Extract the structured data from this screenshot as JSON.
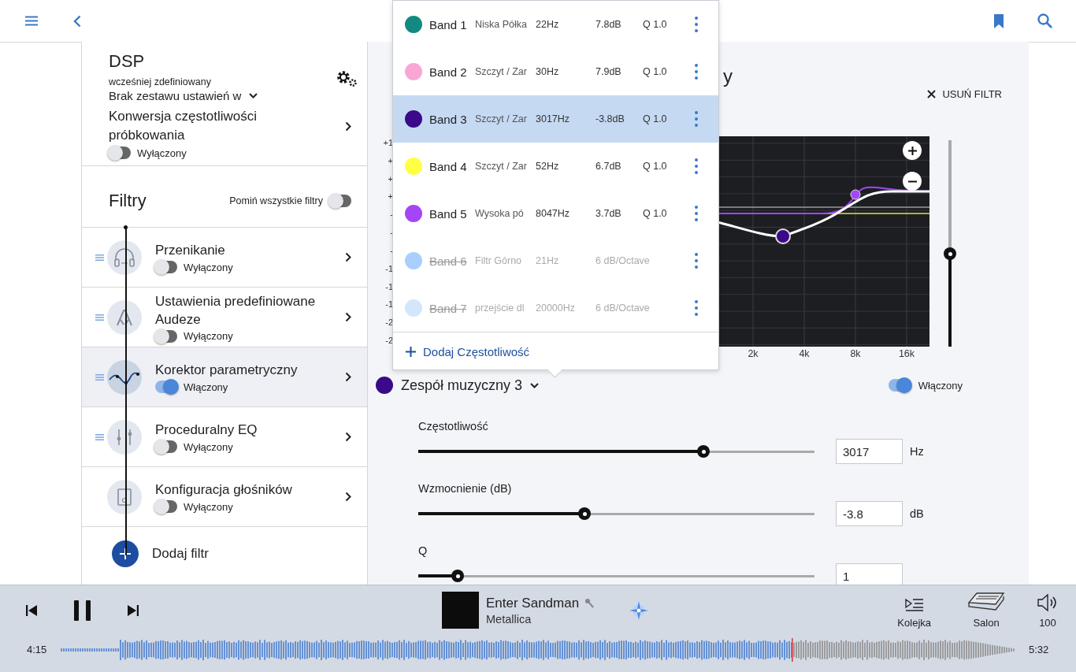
{
  "dsp": {
    "title": "DSP",
    "preset_label": "wcześniej zdefiniowany",
    "preset_value": "Brak zestawu ustawień w",
    "sample_rate_conversion": {
      "label": "Konwersja częstotliwości próbkowania",
      "on": false,
      "status": "Wyłączony"
    }
  },
  "filters": {
    "title": "Filtry",
    "bypass_all": {
      "label": "Pomiń wszystkie filtry",
      "on": false
    },
    "items": [
      {
        "name": "Przenikanie",
        "kind": "crossfeed",
        "on": false,
        "status": "Wyłączony",
        "selected": false,
        "draggable": true
      },
      {
        "name": "Ustawienia predefiniowane Audeze",
        "kind": "preset",
        "on": false,
        "status": "Wyłączony",
        "selected": false,
        "draggable": true
      },
      {
        "name": "Korektor parametryczny",
        "kind": "parametric",
        "on": true,
        "status": "Włączony",
        "selected": true,
        "draggable": true
      },
      {
        "name": "Proceduralny EQ",
        "kind": "procedural",
        "on": false,
        "status": "Wyłączony",
        "selected": false,
        "draggable": true
      },
      {
        "name": "Konfiguracja głośników",
        "kind": "speakers",
        "on": false,
        "status": "Wyłączony",
        "selected": false,
        "draggable": false
      }
    ],
    "add_label": "Dodaj filtr"
  },
  "bands_popup": {
    "bands": [
      {
        "name": "Band 1",
        "type": "Niska Półka",
        "frequency": "22Hz",
        "gain": "7.8dB",
        "q": "Q 1.0",
        "color": "#138a80",
        "enabled": true,
        "selected": false
      },
      {
        "name": "Band 2",
        "type": "Szczyt / Zar",
        "frequency": "30Hz",
        "gain": "7.9dB",
        "q": "Q 1.0",
        "color": "#f9a6d4",
        "enabled": true,
        "selected": false
      },
      {
        "name": "Band 3",
        "type": "Szczyt / Zar",
        "frequency": "3017Hz",
        "gain": "-3.8dB",
        "q": "Q 1.0",
        "color": "#3a0a8a",
        "enabled": true,
        "selected": true
      },
      {
        "name": "Band 4",
        "type": "Szczyt / Zar",
        "frequency": "52Hz",
        "gain": "6.7dB",
        "q": "Q 1.0",
        "color": "#ffff44",
        "enabled": true,
        "selected": false
      },
      {
        "name": "Band 5",
        "type": "Wysoka pó",
        "frequency": "8047Hz",
        "gain": "3.7dB",
        "q": "Q 1.0",
        "color": "#a445f7",
        "enabled": true,
        "selected": false
      },
      {
        "name": "Band 6",
        "type": "Filtr Górno",
        "frequency": "21Hz",
        "gain": "6 dB/Octave",
        "color": "#a8cffd",
        "enabled": false,
        "selected": false
      },
      {
        "name": "Band 7",
        "type": "przejście dl",
        "frequency": "20000Hz",
        "gain": "6 dB/Octave",
        "color": "#d4e6fc",
        "enabled": false,
        "selected": false
      }
    ],
    "add_label": "Dodaj Częstotliwość"
  },
  "editor": {
    "title_fragment": "y",
    "remove_label": "USUŃ FILTR",
    "y_axis_labels": [
      "+1",
      "+",
      "+",
      "+",
      "-",
      "-",
      "-",
      "-1",
      "-1",
      "-1",
      "-2",
      "-2"
    ],
    "x_axis_labels": [
      "2k",
      "4k",
      "8k",
      "16k"
    ],
    "vertical_slider": {
      "level": 0.45
    },
    "band_selector": {
      "label": "Zespół muzyczny 3",
      "color": "#3a0a8a"
    },
    "band_toggle": {
      "on": true,
      "status": "Włączony"
    },
    "params": [
      {
        "label": "Częstotliwość",
        "level": 0.72,
        "value": "3017",
        "unit": "Hz"
      },
      {
        "label": "Wzmocnienie (dB)",
        "level": 0.42,
        "value": "-3.8",
        "unit": "dB"
      },
      {
        "label": "Q",
        "level": 0.1,
        "value": "1"
      }
    ]
  },
  "player": {
    "title": "Enter Sandman",
    "artist": "Metallica",
    "elapsed": "4:15",
    "duration": "5:32",
    "level": 0.767,
    "queue_label": "Kolejka",
    "zone_label": "Salon",
    "volume": "100"
  }
}
